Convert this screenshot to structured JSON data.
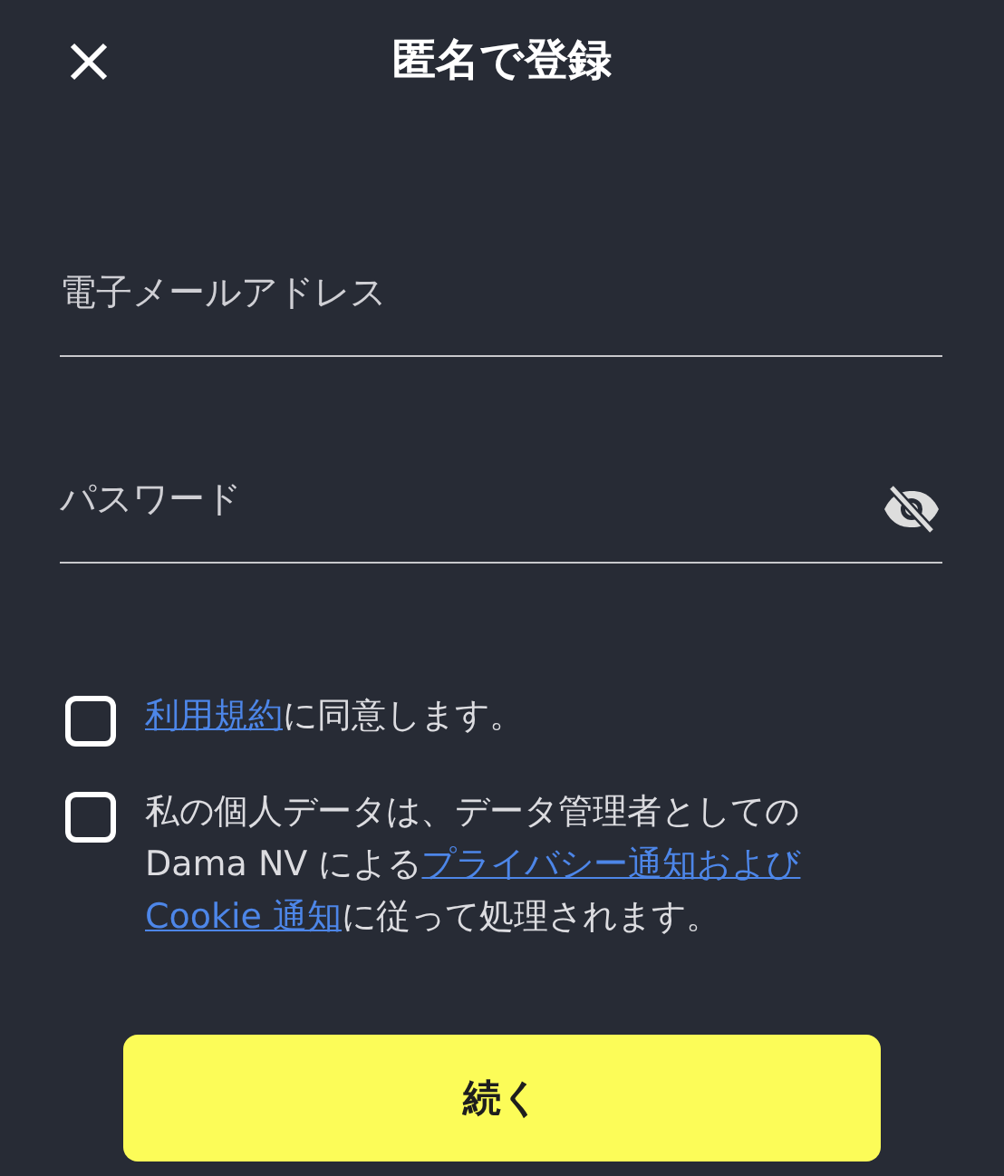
{
  "header": {
    "title": "匿名で登録"
  },
  "fields": [
    {
      "kind": "email",
      "placeholder": "電子メールアドレス"
    },
    {
      "kind": "password",
      "placeholder": "パスワード",
      "password_visible": false
    }
  ],
  "consents": [
    {
      "checked": false,
      "parts": [
        {
          "kind": "link",
          "text": "利用規約"
        },
        {
          "kind": "text",
          "text": "に同意します。"
        }
      ]
    },
    {
      "checked": false,
      "parts": [
        {
          "kind": "text",
          "text": "私の個人データは、データ管理者としての Dama NV による"
        },
        {
          "kind": "link",
          "text": "プライバシー通知および"
        },
        {
          "kind": "link",
          "text": "Cookie 通知"
        },
        {
          "kind": "text",
          "text": "に従って処理されます。"
        }
      ]
    }
  ],
  "submit": {
    "label": "続く"
  }
}
